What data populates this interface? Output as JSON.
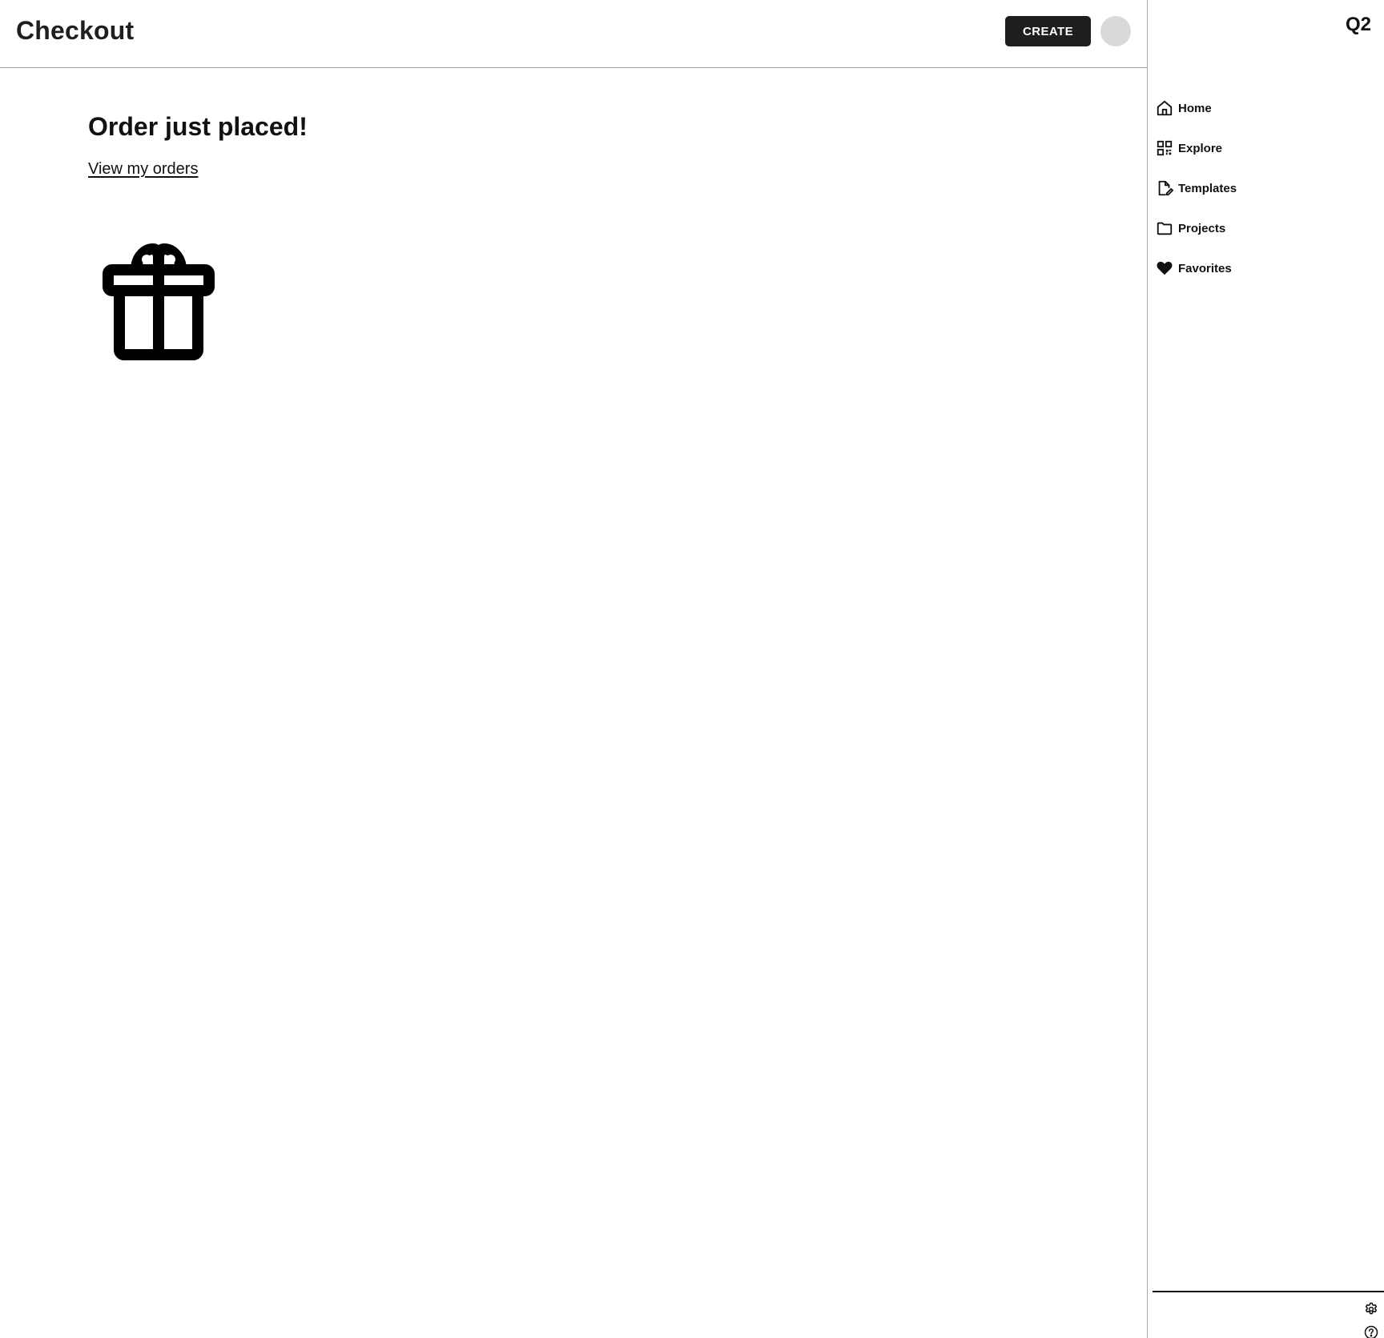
{
  "header": {
    "title": "Checkout",
    "create_label": "CREATE"
  },
  "main": {
    "headline": "Order just placed!",
    "orders_link": "View my orders",
    "illustration_icon": "gift-icon"
  },
  "sidebar": {
    "brand": "Q2",
    "items": [
      {
        "label": "Home",
        "icon": "home-icon"
      },
      {
        "label": "Explore",
        "icon": "grid-icon"
      },
      {
        "label": "Templates",
        "icon": "edit-file-icon"
      },
      {
        "label": "Projects",
        "icon": "folder-icon"
      },
      {
        "label": "Favorites",
        "icon": "heart-icon"
      }
    ],
    "footer_icons": [
      "settings-icon",
      "help-icon"
    ]
  },
  "colors": {
    "button_bg": "#1e1e1e",
    "avatar_bg": "#d9d9d9",
    "divider": "#a8a8a8"
  }
}
